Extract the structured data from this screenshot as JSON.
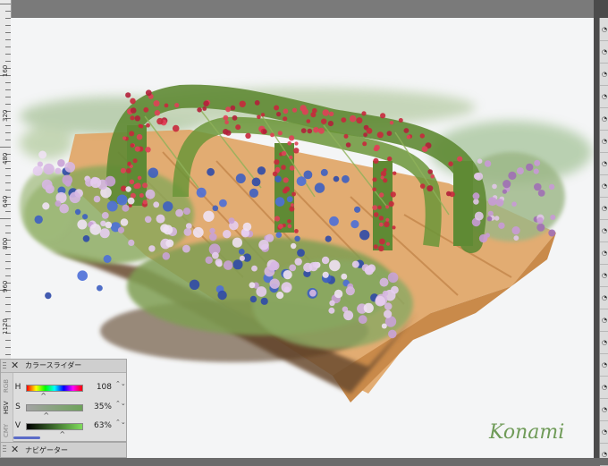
{
  "ruler": {
    "labels": [
      "160",
      "320",
      "480",
      "640",
      "800",
      "960",
      "1120",
      "1280"
    ]
  },
  "canvas": {
    "signature": "Konami"
  },
  "color_slider": {
    "title": "カラースライダー",
    "mode_tabs": [
      "RGB",
      "HSV",
      "CMY"
    ],
    "active_mode": "HSV",
    "rows": [
      {
        "label": "H",
        "value": "108",
        "fraction": 0.3
      },
      {
        "label": "S",
        "value": "35%",
        "fraction": 0.35
      },
      {
        "label": "V",
        "value": "63%",
        "fraction": 0.63
      }
    ],
    "gradients": {
      "hue": [
        "#ff0000",
        "#ffff00",
        "#00ff00",
        "#00ffff",
        "#0000ff",
        "#ff00ff",
        "#ff0000"
      ],
      "sat": [
        "#a3a3a3",
        "#6ea35a"
      ],
      "val": [
        "#000000",
        "#7fdc5c"
      ]
    },
    "close_glyph": "✕",
    "spin_glyph": "⌃⌄",
    "knob_glyph": "^"
  },
  "navigator": {
    "title": "ナビゲーター",
    "close_glyph": "✕"
  },
  "layer_panel": {
    "eye_glyph": "◔"
  },
  "colors": {
    "canvas_bg": "#f4f5f6",
    "path": "#dc9a52",
    "foliage": "#6d8f3c",
    "rose": "#c8283c",
    "blue_flower": "#3d5fc2",
    "pink_flower": "#d7b7e3",
    "soil": "#6a4a2e"
  }
}
